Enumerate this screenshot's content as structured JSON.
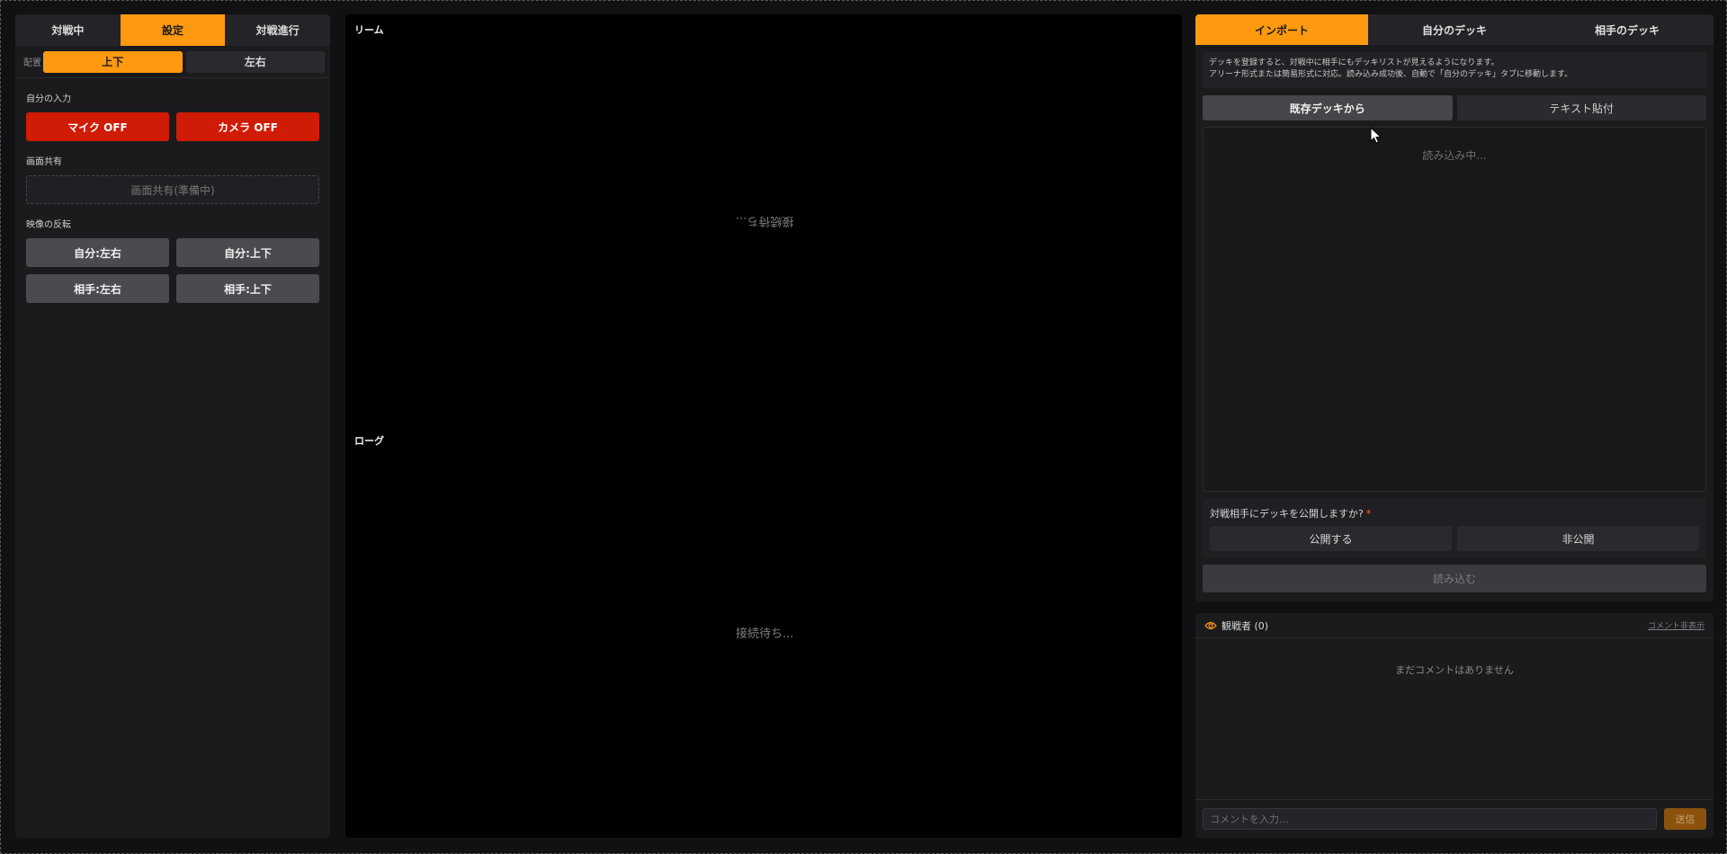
{
  "left": {
    "tabs": [
      {
        "label": "対戦中",
        "active": false
      },
      {
        "label": "設定",
        "active": true
      },
      {
        "label": "対戦進行",
        "active": false
      }
    ],
    "layout": {
      "label": "配置",
      "options": [
        {
          "label": "上下",
          "active": true
        },
        {
          "label": "左右",
          "active": false
        }
      ]
    },
    "input": {
      "title": "自分の入力",
      "mic_label": "マイク OFF",
      "camera_label": "カメラ OFF"
    },
    "screen_share": {
      "title": "画面共有",
      "button_label": "画面共有(準備中)"
    },
    "flip": {
      "title": "映像の反転",
      "self_lr": "自分:左右",
      "self_ud": "自分:上下",
      "opp_lr": "相手:左右",
      "opp_ud": "相手:上下"
    }
  },
  "center": {
    "top_label": "リーム",
    "top_waiting": "接続待ち...",
    "bottom_label": "ローグ",
    "bottom_waiting": "接続待ち..."
  },
  "right": {
    "tabs": [
      {
        "label": "インポート",
        "active": true
      },
      {
        "label": "自分のデッキ",
        "active": false
      },
      {
        "label": "相手のデッキ",
        "active": false
      }
    ],
    "info_line1": "デッキを登録すると、対戦中に相手にもデッキリストが見えるようになります。",
    "info_line2": "アリーナ形式または簡易形式に対応。読み込み成功後、自動で「自分のデッキ」タブに移動します。",
    "source_options": [
      {
        "label": "既存デッキから",
        "active": true
      },
      {
        "label": "テキスト貼付",
        "active": false
      }
    ],
    "loading_text": "読み込み中...",
    "publish_question": "対戦相手にデッキを公開しますか?",
    "publish_required_mark": "*",
    "publish_yes": "公開する",
    "publish_no": "非公開",
    "load_button": "読み込む"
  },
  "viewers": {
    "label": "観戦者 (0)",
    "hide_comments": "コメント非表示",
    "empty_text": "まだコメントはありません",
    "input_placeholder": "コメントを入力...",
    "send_label": "送信"
  },
  "icons": {
    "eye": "eye-icon",
    "cursor": "mouse-cursor-icon"
  },
  "colors": {
    "accent": "#ff9a10",
    "danger": "#d01b06",
    "background": "#000000",
    "panel": "#1b1b1e"
  }
}
